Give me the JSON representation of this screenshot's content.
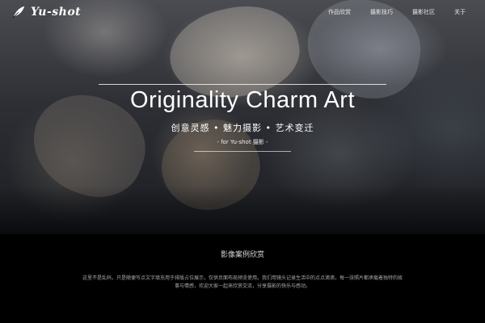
{
  "brand": {
    "name": "Yu-shot",
    "logo_icon": "feather-icon"
  },
  "nav": {
    "items": [
      {
        "label": "作品欣赏"
      },
      {
        "label": "摄影技巧"
      },
      {
        "label": "摄影社区"
      },
      {
        "label": "关于"
      }
    ]
  },
  "hero": {
    "title": "Originality Charm Art",
    "subtitle": "创意灵感 • 魅力摄影 • 艺术变迁",
    "tag": "- for Yu-shot 摄影 -"
  },
  "section": {
    "title": "影像案例欣赏",
    "body": "这里不是乱码，只是随便写点文字填充用于排版占位展示，仅供页面布局预览使用。我们用镜头记录生活中的点点滴滴，每一张照片都承载着独特的故事与情感，欢迎大家一起来欣赏交流，分享摄影的快乐与感动。"
  },
  "colors": {
    "background": "#000000",
    "text": "#ffffff",
    "muted": "#a9a9a9"
  }
}
